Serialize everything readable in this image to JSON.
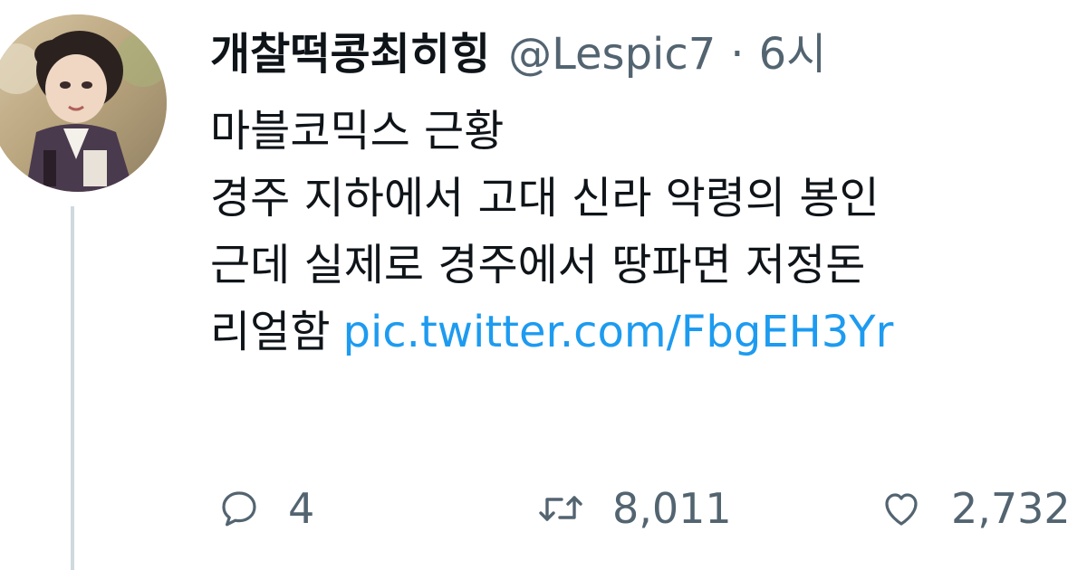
{
  "tweet": {
    "display_name": "개찰떡콩최히힝",
    "handle": "@Lespic7",
    "separator": "·",
    "time": "6시",
    "body_lines": [
      "마블코믹스 근황",
      "경주 지하에서 고대 신라 악령의 봉인",
      "근데 실제로 경주에서 땅파면 저정돈",
      "리얼함"
    ],
    "link_text": "pic.twitter.com/FbgEH3Yr",
    "actions": {
      "reply_icon": "speech-bubble-icon",
      "reply_count": "4",
      "retweet_icon": "retweet-arrows-icon",
      "retweet_count": "8,011",
      "like_icon": "heart-icon",
      "like_count": "2,732"
    }
  },
  "colors": {
    "text": "#0f1419",
    "secondary": "#536471",
    "link": "#1d9bf0",
    "thread_line": "#cfd9de"
  }
}
